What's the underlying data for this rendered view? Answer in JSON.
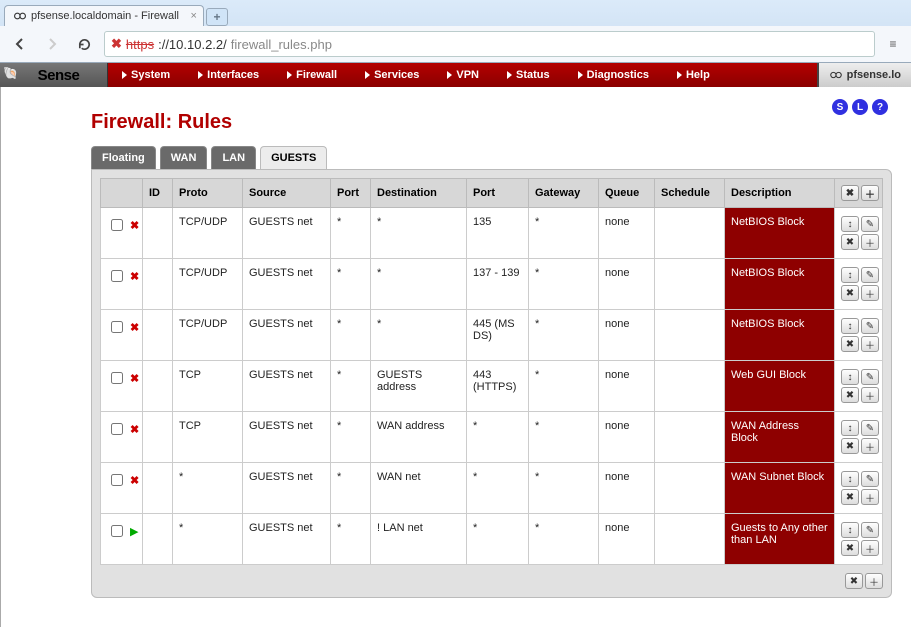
{
  "browser": {
    "tab_title": "pfsense.localdomain - Firewall",
    "url_scheme": "https",
    "url_host": "://10.10.2.2/",
    "url_path": "firewall_rules.php"
  },
  "top_menu": {
    "items": [
      "System",
      "Interfaces",
      "Firewall",
      "Services",
      "VPN",
      "Status",
      "Diagnostics",
      "Help"
    ],
    "hostname": "pfsense.lo"
  },
  "page_title": "Firewall: Rules",
  "help_badges": [
    "S",
    "L",
    "?"
  ],
  "tabs": [
    "Floating",
    "WAN",
    "LAN",
    "GUESTS"
  ],
  "active_tab": "GUESTS",
  "columns": [
    "",
    "ID",
    "Proto",
    "Source",
    "Port",
    "Destination",
    "Port",
    "Gateway",
    "Queue",
    "Schedule",
    "Description",
    ""
  ],
  "rows": [
    {
      "action": "block",
      "id": "",
      "proto": "TCP/UDP",
      "source": "GUESTS net",
      "sport": "*",
      "dest": "*",
      "dport": "135",
      "gateway": "*",
      "queue": "none",
      "schedule": "",
      "desc": "NetBIOS Block"
    },
    {
      "action": "block",
      "id": "",
      "proto": "TCP/UDP",
      "source": "GUESTS net",
      "sport": "*",
      "dest": "*",
      "dport": "137 - 139",
      "gateway": "*",
      "queue": "none",
      "schedule": "",
      "desc": "NetBIOS Block"
    },
    {
      "action": "block",
      "id": "",
      "proto": "TCP/UDP",
      "source": "GUESTS net",
      "sport": "*",
      "dest": "*",
      "dport": "445 (MS DS)",
      "gateway": "*",
      "queue": "none",
      "schedule": "",
      "desc": "NetBIOS Block"
    },
    {
      "action": "block",
      "id": "",
      "proto": "TCP",
      "source": "GUESTS net",
      "sport": "*",
      "dest": "GUESTS address",
      "dport": "443 (HTTPS)",
      "gateway": "*",
      "queue": "none",
      "schedule": "",
      "desc": "Web GUI Block"
    },
    {
      "action": "block",
      "id": "",
      "proto": "TCP",
      "source": "GUESTS net",
      "sport": "*",
      "dest": "WAN address",
      "dport": "*",
      "gateway": "*",
      "queue": "none",
      "schedule": "",
      "desc": "WAN Address Block"
    },
    {
      "action": "block",
      "id": "",
      "proto": "*",
      "source": "GUESTS net",
      "sport": "*",
      "dest": "WAN net",
      "dport": "*",
      "gateway": "*",
      "queue": "none",
      "schedule": "",
      "desc": "WAN Subnet Block"
    },
    {
      "action": "pass",
      "id": "",
      "proto": "*",
      "source": "GUESTS net",
      "sport": "*",
      "dest": "! LAN net",
      "dport": "*",
      "gateway": "*",
      "queue": "none",
      "schedule": "",
      "desc": "Guests to Any other than LAN"
    }
  ],
  "action_glyphs": {
    "block": "✖",
    "pass": "▶"
  }
}
